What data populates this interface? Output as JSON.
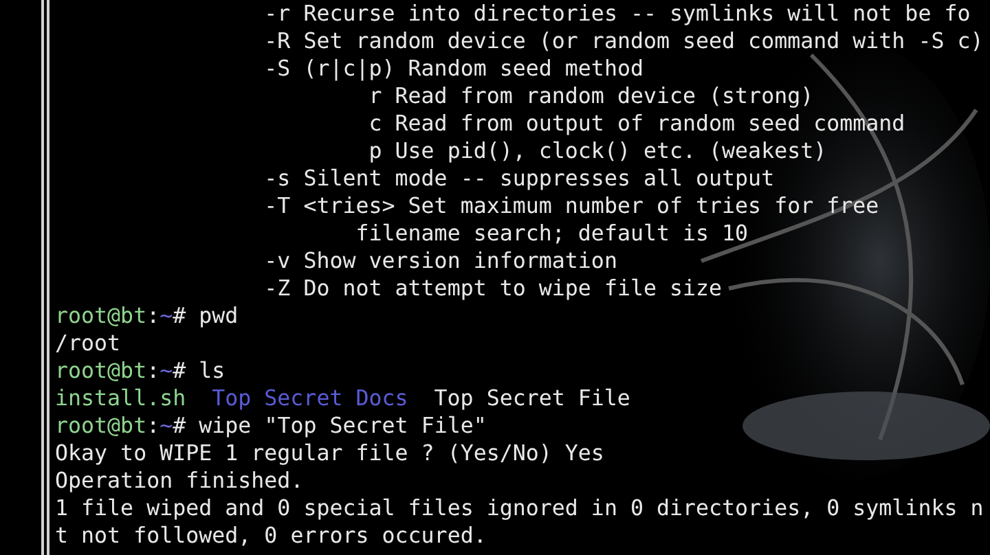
{
  "terminal": {
    "lines": [
      {
        "kind": "output",
        "text": "                -r Recurse into directories -- symlinks will not be fo"
      },
      {
        "kind": "output",
        "text": "                -R Set random device (or random seed command with -S c)"
      },
      {
        "kind": "output",
        "text": "                -S (r|c|p) Random seed method"
      },
      {
        "kind": "output",
        "text": "                        r Read from random device (strong)"
      },
      {
        "kind": "output",
        "text": "                        c Read from output of random seed command"
      },
      {
        "kind": "output",
        "text": "                        p Use pid(), clock() etc. (weakest)"
      },
      {
        "kind": "output",
        "text": "                -s Silent mode -- suppresses all output"
      },
      {
        "kind": "output",
        "text": "                -T <tries> Set maximum number of tries for free"
      },
      {
        "kind": "output",
        "text": "                       filename search; default is 10"
      },
      {
        "kind": "output",
        "text": "                -v Show version information"
      },
      {
        "kind": "output",
        "text": "                -Z Do not attempt to wipe file size"
      },
      {
        "kind": "prompt",
        "user_host": "root@bt",
        "separator": ":",
        "path": "~",
        "symbol": "#",
        "command": "pwd"
      },
      {
        "kind": "output",
        "text": "/root"
      },
      {
        "kind": "prompt",
        "user_host": "root@bt",
        "separator": ":",
        "path": "~",
        "symbol": "#",
        "command": "ls"
      },
      {
        "kind": "listing",
        "items": [
          {
            "name": "install.sh",
            "kind": "executable"
          },
          {
            "name": "Top Secret Docs",
            "kind": "directory"
          },
          {
            "name": "Top Secret File",
            "kind": "file"
          }
        ]
      },
      {
        "kind": "prompt",
        "user_host": "root@bt",
        "separator": ":",
        "path": "~",
        "symbol": "#",
        "command": "wipe \"Top Secret File\""
      },
      {
        "kind": "output",
        "text": "Okay to WIPE 1 regular file ? (Yes/No) Yes"
      },
      {
        "kind": "output",
        "text": "Operation finished."
      },
      {
        "kind": "output",
        "text": "1 file wiped and 0 special files ignored in 0 directories, 0 symlinks n"
      },
      {
        "kind": "output",
        "text": "t not followed, 0 errors occured."
      }
    ]
  }
}
